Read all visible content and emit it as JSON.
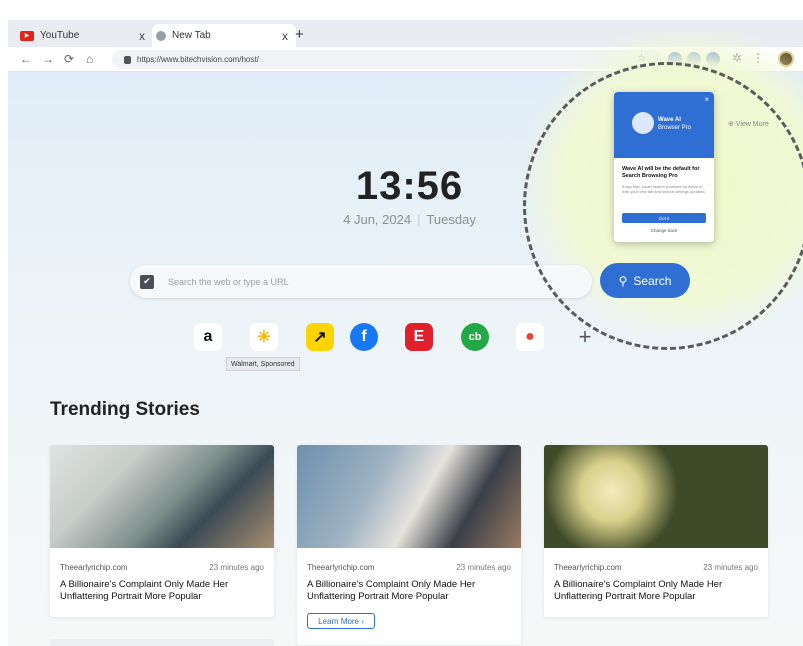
{
  "browser": {
    "tabs": [
      {
        "label": "YouTube",
        "close": "x"
      },
      {
        "label": "New Tab",
        "close": "x"
      }
    ],
    "new_tab": "+",
    "url": "https://www.bitechvision.com/host/",
    "nav": {
      "back": "←",
      "forward": "→",
      "reload": "⟳",
      "home": "⌂"
    }
  },
  "clock": {
    "time": "13:56",
    "date": "4 Jun, 2024",
    "weekday": "Tuesday"
  },
  "search": {
    "placeholder": "Search the web or type a URL",
    "button": "Search"
  },
  "shortcuts": [
    {
      "name": "amazon",
      "glyph": "a",
      "bg": "#ffffff",
      "fg": "#111111"
    },
    {
      "name": "walmart",
      "glyph": "✳",
      "bg": "#ffffff",
      "fg": "#f7b500"
    },
    {
      "name": "arrow-app",
      "glyph": "↗",
      "bg": "#ffd400",
      "fg": "#111111"
    },
    {
      "name": "facebook",
      "glyph": "f",
      "bg": "#1877f2",
      "fg": "#ffffff"
    },
    {
      "name": "e-shop",
      "glyph": "E",
      "bg": "#e0202b",
      "fg": "#ffffff"
    },
    {
      "name": "cashback",
      "glyph": "cb",
      "bg": "#22a845",
      "fg": "#ffffff"
    },
    {
      "name": "maps",
      "glyph": "●",
      "bg": "#ffffff",
      "fg": "#ea4335"
    },
    {
      "name": "add",
      "glyph": "+",
      "bg": "transparent",
      "fg": "#555555"
    }
  ],
  "tooltip": "Walmart, Sponsored",
  "trending": {
    "heading": "Trending Stories",
    "cards": [
      {
        "source": "Theearlyrichip.com",
        "ago": "23 minutes ago",
        "title": "A Billionaire's Complaint Only Made Her Unflattering Portrait More Popular"
      },
      {
        "source": "Theearlyrichip.com",
        "ago": "23 minutes ago",
        "title": "A Billionaire's Complaint Only Made Her Unflattering Portrait More Popular",
        "button": "Learn More"
      },
      {
        "source": "Theearlyrichip.com",
        "ago": "23 minutes ago",
        "title": "A Billionaire's Complaint Only Made Her Unflattering Portrait More Popular"
      }
    ]
  },
  "popup": {
    "close": "×",
    "brand": "Wave AI",
    "brand_sub": "Browser Pro",
    "title": "Wave AI will be the default for Search Browsing Pro",
    "body": "Enjoy fast, smart search powered by Wave AI with your new tab and search settings updated.",
    "primary": "Got it",
    "secondary": "Change back"
  },
  "view_more": "View More",
  "colors": {
    "accent": "#2f6fd3",
    "page_bg": "#e7f0f7",
    "highlight": "#eef7c8"
  }
}
